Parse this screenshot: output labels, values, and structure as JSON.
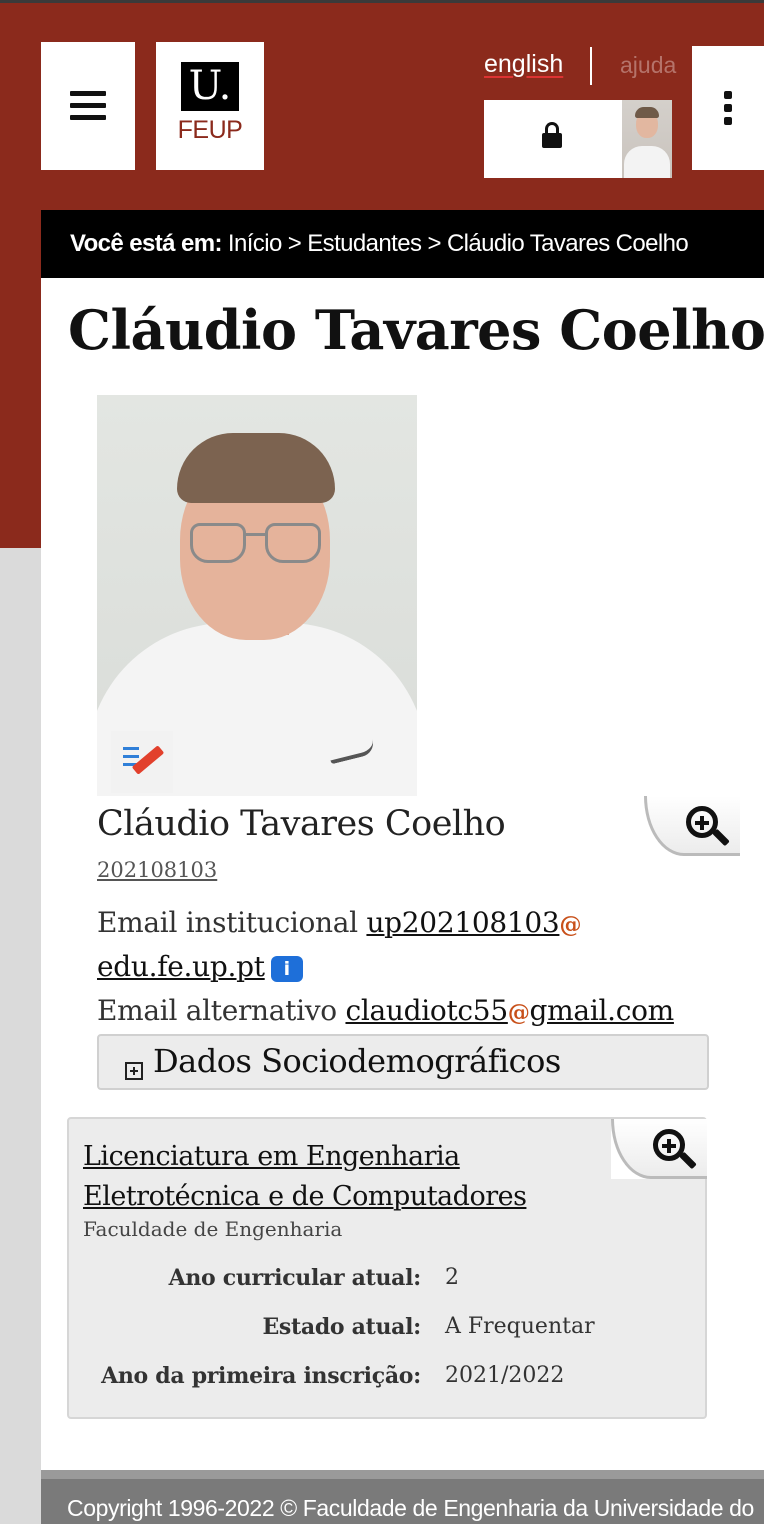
{
  "header": {
    "logo_mark": "U.",
    "logo_text": "FEUP",
    "language_link": "english",
    "help_link": "ajuda"
  },
  "breadcrumb": {
    "prefix": "Você está em:",
    "items": [
      "Início",
      "Estudantes",
      "Cláudio Tavares Coelho"
    ],
    "separator": ">"
  },
  "page": {
    "title": "Cláudio Tavares Coelho"
  },
  "profile": {
    "name": "Cláudio Tavares Coelho",
    "number": "202108103",
    "institutional_email_label": "Email institucional",
    "institutional_email_user": "up202108103",
    "institutional_email_at": "@",
    "institutional_email_domain": "edu.fe.up.pt",
    "info_glyph": "i",
    "alternative_email_label": "Email alternativo",
    "alternative_email_user": "claudiotc55",
    "alternative_email_at": "@",
    "alternative_email_domain": "gmail.com"
  },
  "sociodemographic": {
    "label": "Dados Sociodemográficos"
  },
  "course": {
    "name": "Licenciatura em Engenharia Eletrotécnica e de Computadores",
    "faculty": "Faculdade de Engenharia",
    "rows": [
      {
        "label": "Ano curricular atual:",
        "value": "2"
      },
      {
        "label": "Estado atual:",
        "value": "A Frequentar"
      },
      {
        "label": "Ano da primeira inscrição:",
        "value": "2021/2022"
      }
    ]
  },
  "footer": {
    "text": "Copyright 1996-2022 © Faculdade de Engenharia da Universidade do"
  },
  "icons": [
    "hamburger-icon",
    "lock-icon",
    "kebab-menu-icon",
    "edit-photo-icon",
    "zoom-icon",
    "info-icon",
    "expand-plus-icon"
  ],
  "colors": {
    "brand": "#8b2a1c",
    "at_sign": "#c8501a",
    "info": "#1e6fd9"
  }
}
